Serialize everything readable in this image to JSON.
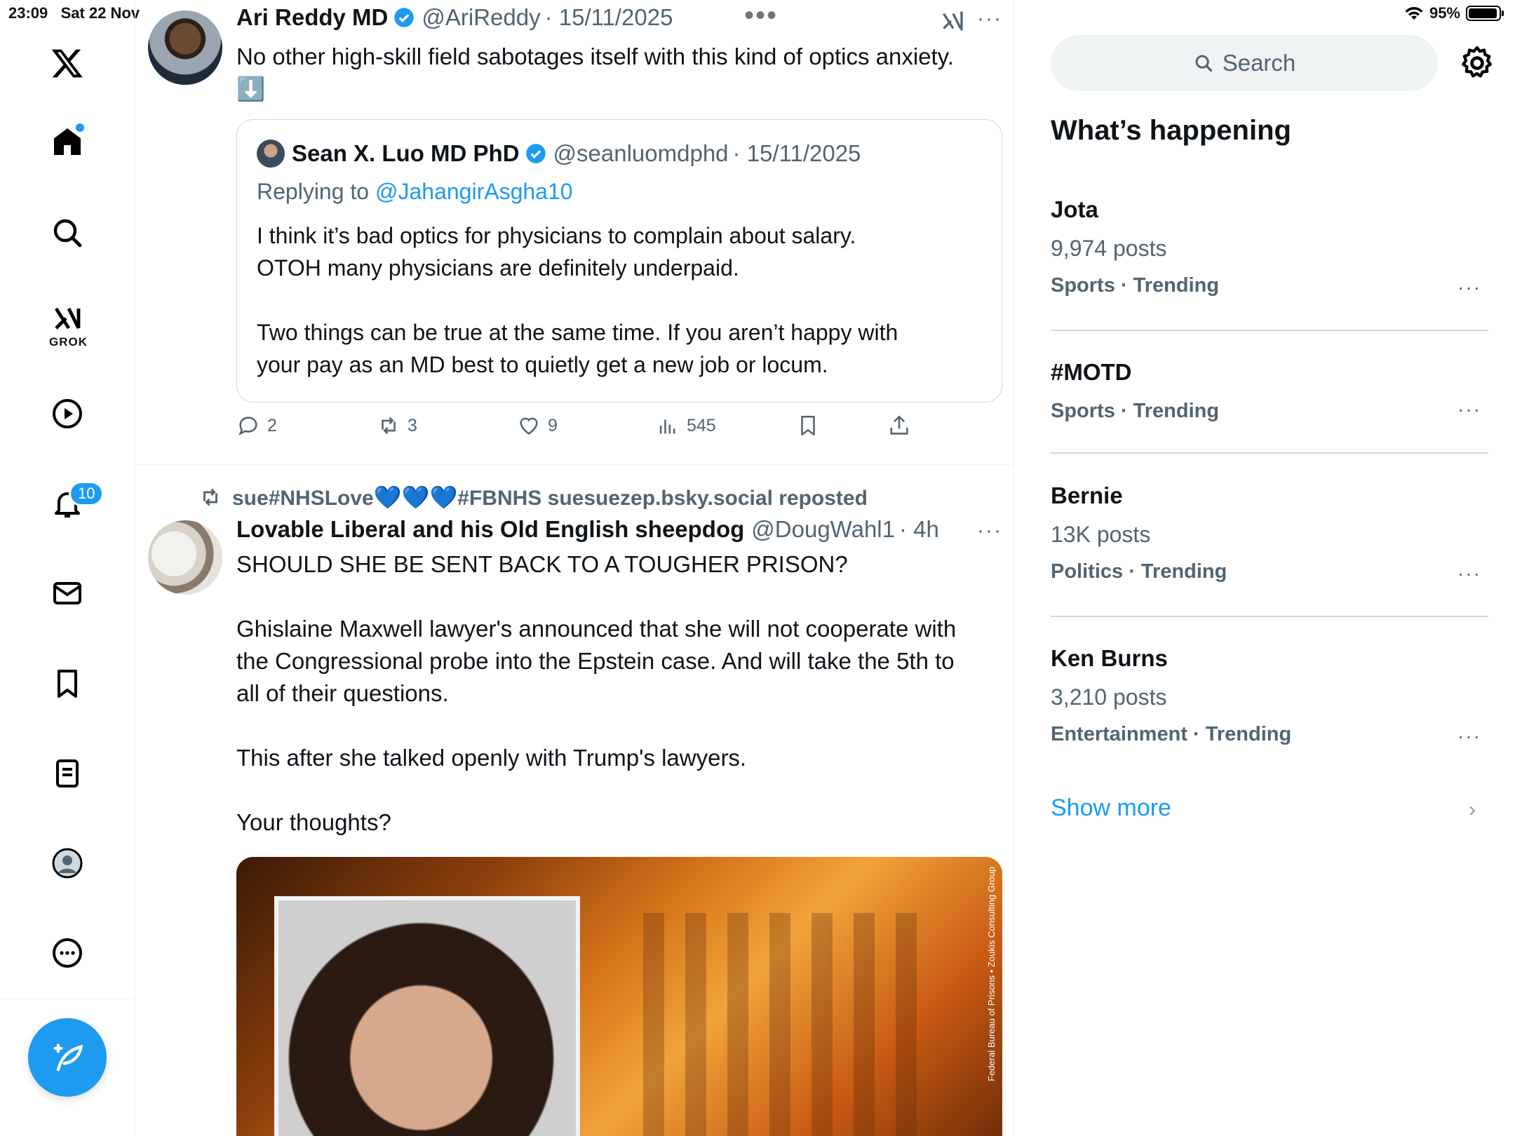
{
  "status_bar": {
    "time": "23:09",
    "date": "Sat 22 Nov",
    "battery": "95%",
    "battery_level": 0.95
  },
  "nav": {
    "items": [
      {
        "name": "x-logo",
        "label": ""
      },
      {
        "name": "home",
        "label": ""
      },
      {
        "name": "explore",
        "label": ""
      },
      {
        "name": "grok",
        "label": "GROK"
      },
      {
        "name": "videos",
        "label": ""
      },
      {
        "name": "notifications",
        "label": ""
      },
      {
        "name": "messages",
        "label": ""
      },
      {
        "name": "bookmarks",
        "label": ""
      },
      {
        "name": "lists",
        "label": ""
      },
      {
        "name": "profile",
        "label": ""
      },
      {
        "name": "more",
        "label": ""
      }
    ],
    "grok_label": "GROK",
    "notifications_badge": "10"
  },
  "tweet1": {
    "name": "Ari Reddy MD",
    "handle": "@AriReddy",
    "date": "· 15/11/2025",
    "text": "No other high-skill field sabotages itself with this kind of optics anxiety.",
    "emoji": "⬇️",
    "quote": {
      "name": "Sean X. Luo MD PhD",
      "handle": "@seanluomdphd",
      "date": "· 15/11/2025",
      "replying_prefix": "Replying to ",
      "replying_handle": "@JahangirAsgha10",
      "para1_line1": "I think it’s bad optics for physicians to complain about salary.",
      "para1_line2": "OTOH many physicians are definitely underpaid.",
      "para2_line1": "Two things can be true at the same time. If you aren’t happy with",
      "para2_line2": "your pay as an MD best to quietly get a new job or locum."
    },
    "replies": "2",
    "reposts": "3",
    "likes": "9",
    "views": "545"
  },
  "tweet2": {
    "repost_user": "sue#NHSLove",
    "repost_tag": "#FBNHS suesuezep.bsky.social reposted",
    "name": "Lovable Liberal and his Old English sheepdog",
    "handle": "@DougWahl1",
    "time": "· 4h",
    "line1": "SHOULD SHE BE SENT BACK TO A TOUGHER PRISON?",
    "line2": "Ghislaine Maxwell lawyer's announced that she will not cooperate with",
    "line3": "the Congressional probe into the Epstein case. And will take the 5th to",
    "line4": "all of their questions.",
    "line5": "This after she talked openly with Trump's lawyers.",
    "line6": "Your thoughts?",
    "media_caption": "Federal Bureau of Prisons • Zoukis Consulting Group"
  },
  "sidebar": {
    "search_placeholder": "Search",
    "title": "What’s happening",
    "trends": [
      {
        "name": "Jota",
        "posts": "9,974 posts",
        "category": "Sports · Trending"
      },
      {
        "name": "#MOTD",
        "posts": "",
        "category": "Sports · Trending"
      },
      {
        "name": "Bernie",
        "posts": "13K posts",
        "category": "Politics · Trending"
      },
      {
        "name": "Ken Burns",
        "posts": "3,210 posts",
        "category": "Entertainment · Trending"
      }
    ],
    "show_more": "Show more"
  },
  "colors": {
    "accent": "#1d9bf0",
    "text": "#0f1419",
    "secondary": "#536471"
  }
}
